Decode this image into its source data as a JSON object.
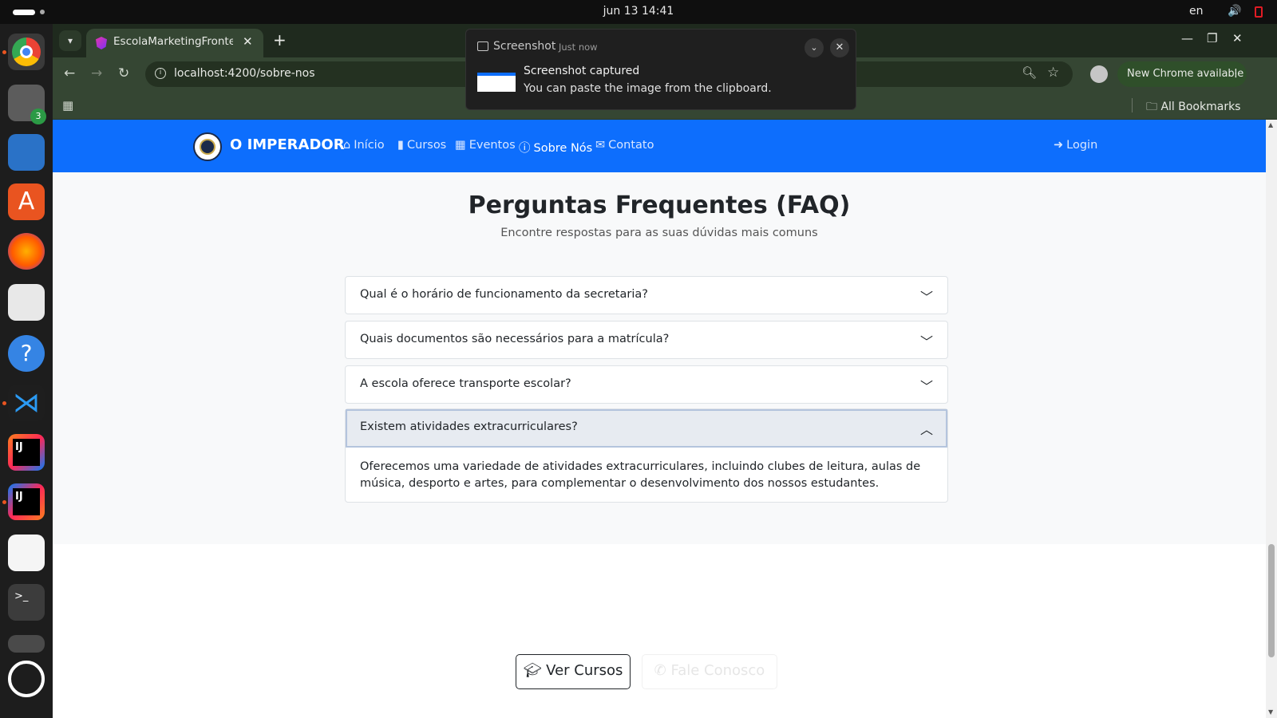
{
  "topbar": {
    "datetime": "jun 13  14:41",
    "language": "en"
  },
  "dock": {
    "files_badge": "3"
  },
  "browser": {
    "tab_title": "EscolaMarketingFrontend",
    "url": "localhost:4200/sobre-nos",
    "new_chrome": "New Chrome available",
    "all_bookmarks": "All Bookmarks"
  },
  "notification": {
    "app": "Screenshot",
    "time": "Just now",
    "title": "Screenshot captured",
    "body": "You can paste the image from the clipboard."
  },
  "site": {
    "brand": "O IMPERADOR",
    "nav": [
      {
        "label": "Início",
        "icon": "home-icon"
      },
      {
        "label": "Cursos",
        "icon": "book-icon"
      },
      {
        "label": "Eventos",
        "icon": "calendar-icon"
      },
      {
        "label": "Sobre Nós",
        "icon": "info-icon",
        "active": true
      },
      {
        "label": "Contato",
        "icon": "envelope-icon"
      }
    ],
    "login": "Login"
  },
  "faq": {
    "title": "Perguntas Frequentes (FAQ)",
    "subtitle": "Encontre respostas para as suas dúvidas mais comuns",
    "items": [
      {
        "question": "Qual é o horário de funcionamento da secretaria?",
        "expanded": false
      },
      {
        "question": "Quais documentos são necessários para a matrícula?",
        "expanded": false
      },
      {
        "question": "A escola oferece transporte escolar?",
        "expanded": false
      },
      {
        "question": "Existem atividades extracurriculares?",
        "expanded": true,
        "answer": "Oferecemos uma variedade de atividades extracurriculares, incluindo clubes de leitura, aulas de música, desporto e artes, para complementar o desenvolvimento dos nossos estudantes."
      }
    ]
  },
  "cta": {
    "courses": "Ver Cursos",
    "talk": "Fale Conosco"
  }
}
